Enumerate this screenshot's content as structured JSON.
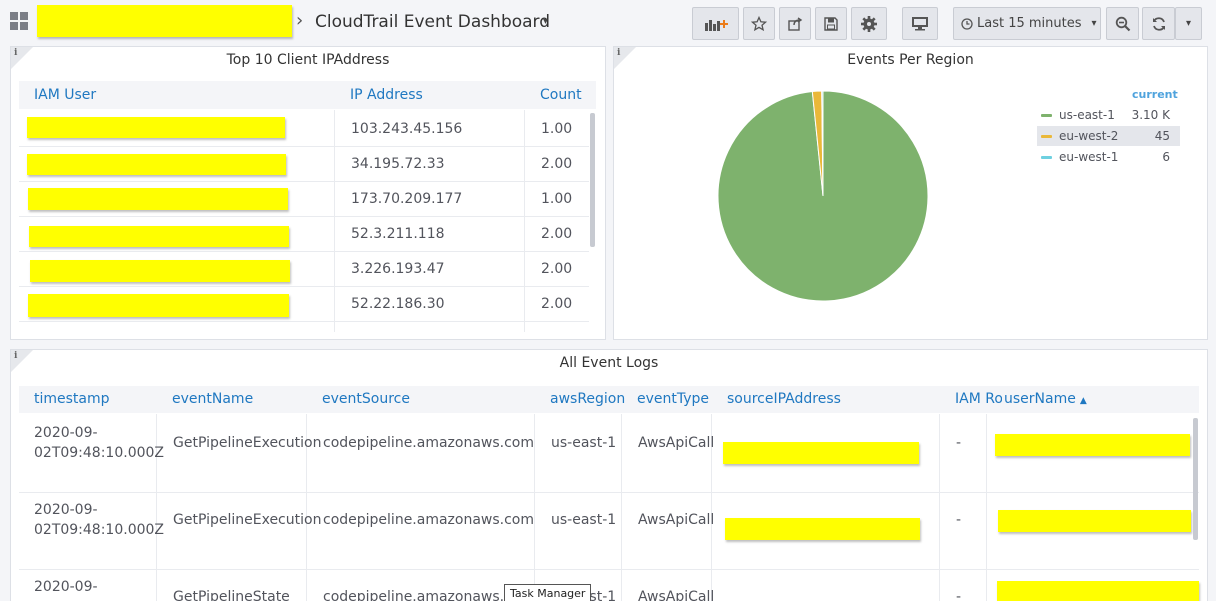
{
  "header": {
    "dashboard_title": "CloudTrail Event Dashboard",
    "breadcrumb_sep": "›",
    "caret": "▾",
    "time_range": "Last 15 minutes"
  },
  "ip_panel": {
    "title": "Top 10 Client IPAddress",
    "info": "i",
    "columns": [
      "IAM User",
      "IP Address",
      "Count"
    ],
    "rows": [
      {
        "ip": "103.243.45.156",
        "count": "1.00"
      },
      {
        "ip": "34.195.72.33",
        "count": "2.00"
      },
      {
        "ip": "173.70.209.177",
        "count": "1.00"
      },
      {
        "ip": "52.3.211.118",
        "count": "2.00"
      },
      {
        "ip": "3.226.193.47",
        "count": "2.00"
      },
      {
        "ip": "52.22.186.30",
        "count": "2.00"
      }
    ]
  },
  "region_panel": {
    "title": "Events Per Region",
    "info": "i",
    "legend_header": "current",
    "legend": [
      {
        "name": "us-east-1",
        "value": "3.10 K",
        "color": "#7eb26d"
      },
      {
        "name": "eu-west-2",
        "value": "45",
        "color": "#eab839"
      },
      {
        "name": "eu-west-1",
        "value": "6",
        "color": "#6ed0e0"
      }
    ]
  },
  "chart_data": {
    "type": "pie",
    "title": "Events Per Region",
    "labels": [
      "us-east-1",
      "eu-west-2",
      "eu-west-1"
    ],
    "values": [
      3100,
      45,
      6
    ],
    "colors": [
      "#7eb26d",
      "#eab839",
      "#6ed0e0"
    ],
    "legend_position": "right"
  },
  "logs_panel": {
    "title": "All Event Logs",
    "info": "i",
    "columns": [
      "timestamp",
      "eventName",
      "eventSource",
      "awsRegion",
      "eventType",
      "sourceIPAddress",
      "IAM Role",
      "userName"
    ],
    "rows": [
      {
        "ts1": "2020-09-",
        "ts2": "02T09:48:10.000Z",
        "eventName": "GetPipelineExecution",
        "eventSource": "codepipeline.amazonaws.com",
        "awsRegion": "us-east-1",
        "eventType": "AwsApiCall",
        "iamRole": "-"
      },
      {
        "ts1": "2020-09-",
        "ts2": "02T09:48:10.000Z",
        "eventName": "GetPipelineExecution",
        "eventSource": "codepipeline.amazonaws.com",
        "awsRegion": "us-east-1",
        "eventType": "AwsApiCall",
        "iamRole": "-"
      },
      {
        "ts1": "2020-09-",
        "ts2": "",
        "eventName": "GetPipelineState",
        "eventSource": "codepipeline.amazonaws.com",
        "awsRegion": "us-east-1",
        "eventType": "AwsApiCall",
        "iamRole": "-"
      }
    ]
  },
  "tooltip": "Task Manager"
}
